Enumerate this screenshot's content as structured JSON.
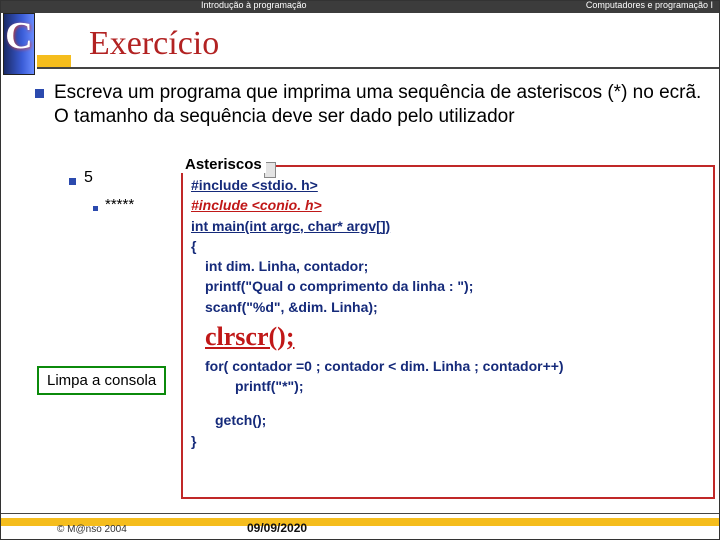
{
  "header": {
    "left": "Introdução à programação",
    "right": "Computadores e programação I"
  },
  "logo_letter": "C",
  "title": "Exercício",
  "prompt": "Escreva um programa que imprima uma sequência de asteriscos (*) no ecrã. O tamanho da sequência deve ser dado pelo utilizador",
  "example_input": "5",
  "example_output": "*****",
  "code_title": "Asteriscos",
  "callout": "Limpa a consola",
  "code": {
    "l1": "#include <stdio. h>",
    "l2": "#include <conio. h>",
    "l3": "int main(int argc, char* argv[])",
    "l4": "{",
    "l5": "int dim. Linha, contador;",
    "l6": "printf(\"Qual o comprimento da linha : \");",
    "l7": "scanf(\"%d\", &dim. Linha);",
    "l8": "clrscr();",
    "l9": "for( contador =0  ; contador < dim. Linha ; contador++)",
    "l10": "printf(\"*\");",
    "l11": "getch();",
    "l12": "}"
  },
  "footer": {
    "copy": "© M@nso 2004",
    "date": "09/09/2020"
  }
}
